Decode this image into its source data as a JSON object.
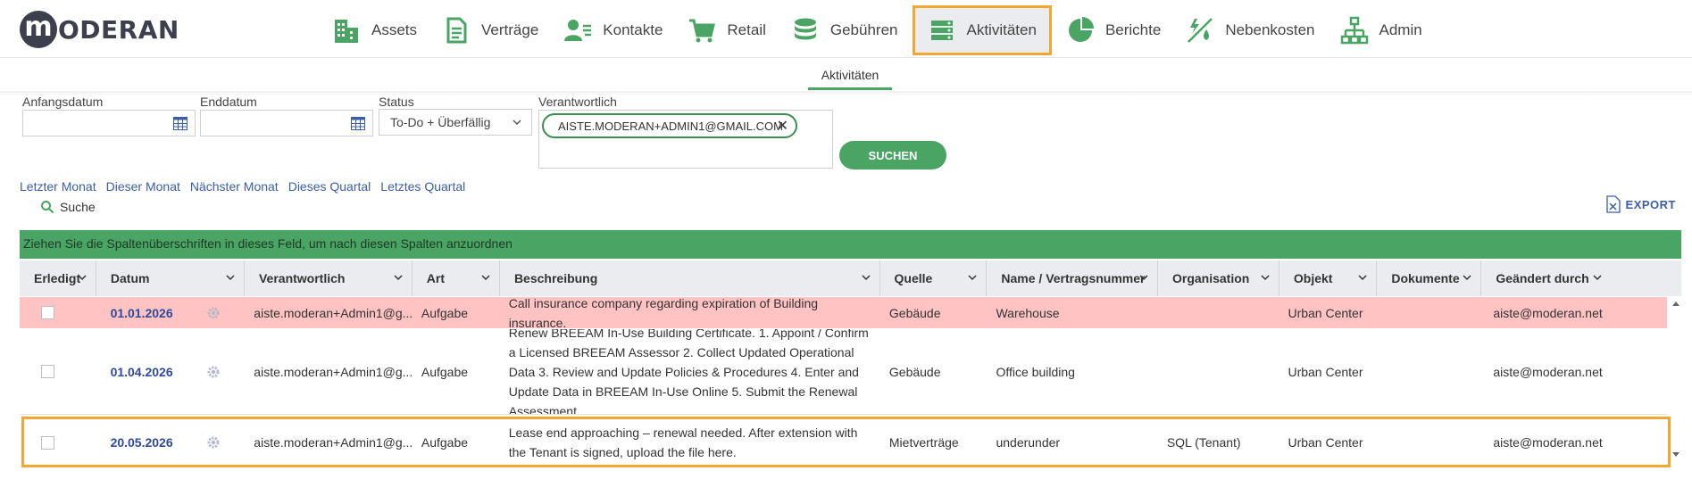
{
  "brand": {
    "logo_letter": "m",
    "logo_rest": "ODERAN"
  },
  "nav": [
    {
      "label": "Assets",
      "icon": "buildings-icon"
    },
    {
      "label": "Verträge",
      "icon": "document-icon"
    },
    {
      "label": "Kontakte",
      "icon": "contacts-icon"
    },
    {
      "label": "Retail",
      "icon": "cart-icon"
    },
    {
      "label": "Gebühren",
      "icon": "coins-icon"
    },
    {
      "label": "Aktivitäten",
      "icon": "activities-icon",
      "active": true
    },
    {
      "label": "Berichte",
      "icon": "pie-chart-icon"
    },
    {
      "label": "Nebenkosten",
      "icon": "utilities-icon"
    },
    {
      "label": "Admin",
      "icon": "org-chart-icon"
    }
  ],
  "subtab": {
    "label": "Aktivitäten"
  },
  "filters": {
    "start_label": "Anfangsdatum",
    "start_value": "",
    "end_label": "Enddatum",
    "end_value": "",
    "status_label": "Status",
    "status_value": "To-Do + Überfällig",
    "responsible_label": "Verantwortlich",
    "responsible_chip": "AISTE.MODERAN+ADMIN1@GMAIL.COM",
    "search_button": "SUCHEN"
  },
  "quick_ranges": [
    "Letzter Monat",
    "Dieser Monat",
    "Nächster Monat",
    "Dieses Quartal",
    "Letztes Quartal"
  ],
  "search_toggle": "Suche",
  "export_label": "EXPORT",
  "group_bar": "Ziehen Sie die Spaltenüberschriften in dieses Feld, um nach diesen Spalten anzuordnen",
  "columns": [
    "Erledigt",
    "Datum",
    "Verantwortlich",
    "Art",
    "Beschreibung",
    "Quelle",
    "Name / Vertragsnummer",
    "Organisation",
    "Objekt",
    "Dokumente",
    "Geändert durch"
  ],
  "rows": [
    {
      "date": "01.01.2026",
      "responsible": "aiste.moderan+Admin1@g...",
      "type": "Aufgabe",
      "description": "Call insurance company regarding expiration of Building insurance.",
      "source": "Gebäude",
      "name": "Warehouse",
      "organisation": "",
      "object": "Urban Center",
      "documents": "",
      "changed_by": "aiste@moderan.net",
      "overdue": true
    },
    {
      "date": "01.04.2026",
      "responsible": "aiste.moderan+Admin1@g...",
      "type": "Aufgabe",
      "description": "Renew BREEAM In-Use Building Certificate. 1. Appoint / Confirm a Licensed BREEAM Assessor 2. Collect Updated Operational Data 3. Review and Update Policies & Procedures 4. Enter and Update Data in BREEAM In-Use Online 5. Submit the Renewal Assessment",
      "source": "Gebäude",
      "name": "Office building",
      "organisation": "",
      "object": "Urban Center",
      "documents": "",
      "changed_by": "aiste@moderan.net",
      "overdue": false
    },
    {
      "date": "20.05.2026",
      "responsible": "aiste.moderan+Admin1@g...",
      "type": "Aufgabe",
      "description": "Lease end approaching – renewal needed. After extension with the Tenant is signed, upload the file here.",
      "source": "Mietverträge",
      "name": "underunder",
      "organisation": "SQL (Tenant)",
      "object": "Urban Center",
      "documents": "",
      "changed_by": "aiste@moderan.net",
      "overdue": false
    }
  ],
  "colors": {
    "accent_green": "#4aa564",
    "highlight": "#f0a830",
    "overdue_row": "#ffc3c3",
    "link_blue": "#3a5ea8"
  }
}
